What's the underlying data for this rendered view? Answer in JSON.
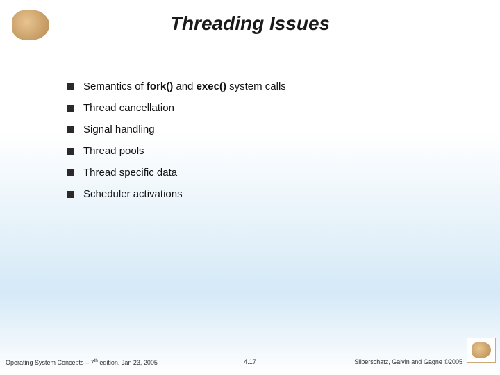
{
  "title": "Threading Issues",
  "bullets": [
    {
      "prefix": "Semantics of ",
      "b1": "fork()",
      "mid": " and ",
      "b2": "exec()",
      "suffix": " system calls"
    },
    {
      "text": "Thread cancellation"
    },
    {
      "text": "Signal handling"
    },
    {
      "text": "Thread pools"
    },
    {
      "text": "Thread specific data"
    },
    {
      "text": "Scheduler activations"
    }
  ],
  "footer": {
    "left_a": "Operating System Concepts – 7",
    "left_sup": "th",
    "left_b": " edition, Jan 23, 2005",
    "center": "4.17",
    "right": "Silberschatz, Galvin and Gagne ©2005"
  }
}
